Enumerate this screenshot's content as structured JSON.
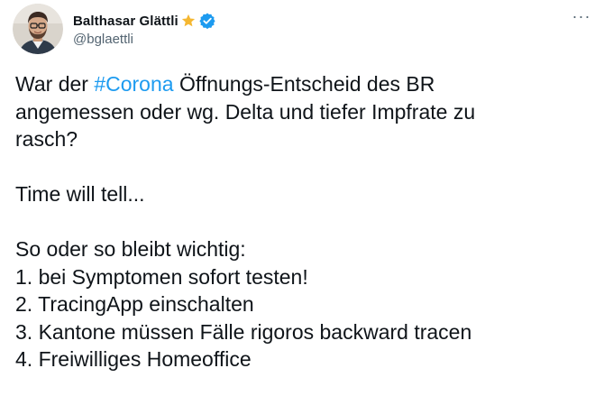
{
  "author": {
    "display_name": "Balthasar Glättli",
    "handle": "@bglaettli",
    "avatar_icon": "profile-photo-avatar",
    "badges": [
      "star-icon",
      "verified-icon"
    ]
  },
  "menu": {
    "more_label": "···"
  },
  "tweet": {
    "line1_prefix": "War der ",
    "hashtag": "#Corona",
    "line1_suffix": " Öffnungs-Entscheid des BR",
    "line2": "angemessen oder wg. Delta und tiefer Impfrate zu",
    "line3": "rasch?",
    "line4": "Time will tell...",
    "line5": "So oder so bleibt wichtig:",
    "list": [
      "1. bei Symptomen sofort testen!",
      "2. TracingApp einschalten",
      "3. Kantone müssen Fälle rigoros backward tracen",
      "4. Freiwilliges Homeoffice"
    ]
  },
  "colors": {
    "text": "#0f1419",
    "secondary": "#536471",
    "link": "#1d9bf0",
    "verified": "#1d9bf0",
    "star": "#f5b731"
  }
}
